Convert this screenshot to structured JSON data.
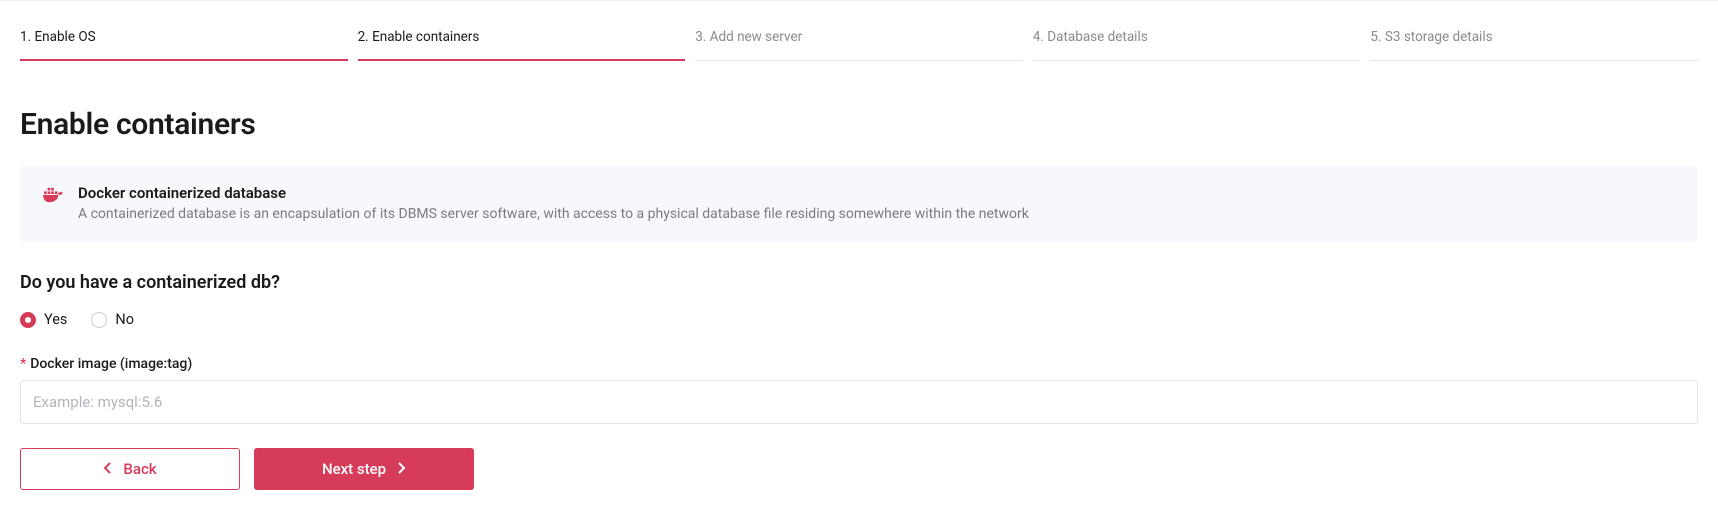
{
  "steps": [
    {
      "label": "1. Enable OS",
      "state": "done"
    },
    {
      "label": "2. Enable containers",
      "state": "current"
    },
    {
      "label": "3. Add new server",
      "state": "pending"
    },
    {
      "label": "4. Database details",
      "state": "pending"
    },
    {
      "label": "5. S3 storage details",
      "state": "pending"
    }
  ],
  "heading": "Enable containers",
  "info": {
    "title": "Docker containerized database",
    "subtitle": "A containerized database is an encapsulation of its DBMS server software, with access to a physical database file residing somewhere within the network"
  },
  "question": "Do you have a containerized db?",
  "radios": {
    "yes": "Yes",
    "no": "No",
    "selected": "yes"
  },
  "field": {
    "label": "Docker image (image:tag)",
    "placeholder": "Example: mysql:5.6",
    "value": ""
  },
  "buttons": {
    "back": "Back",
    "next": "Next step"
  },
  "colors": {
    "accent": "#d63b5a"
  }
}
